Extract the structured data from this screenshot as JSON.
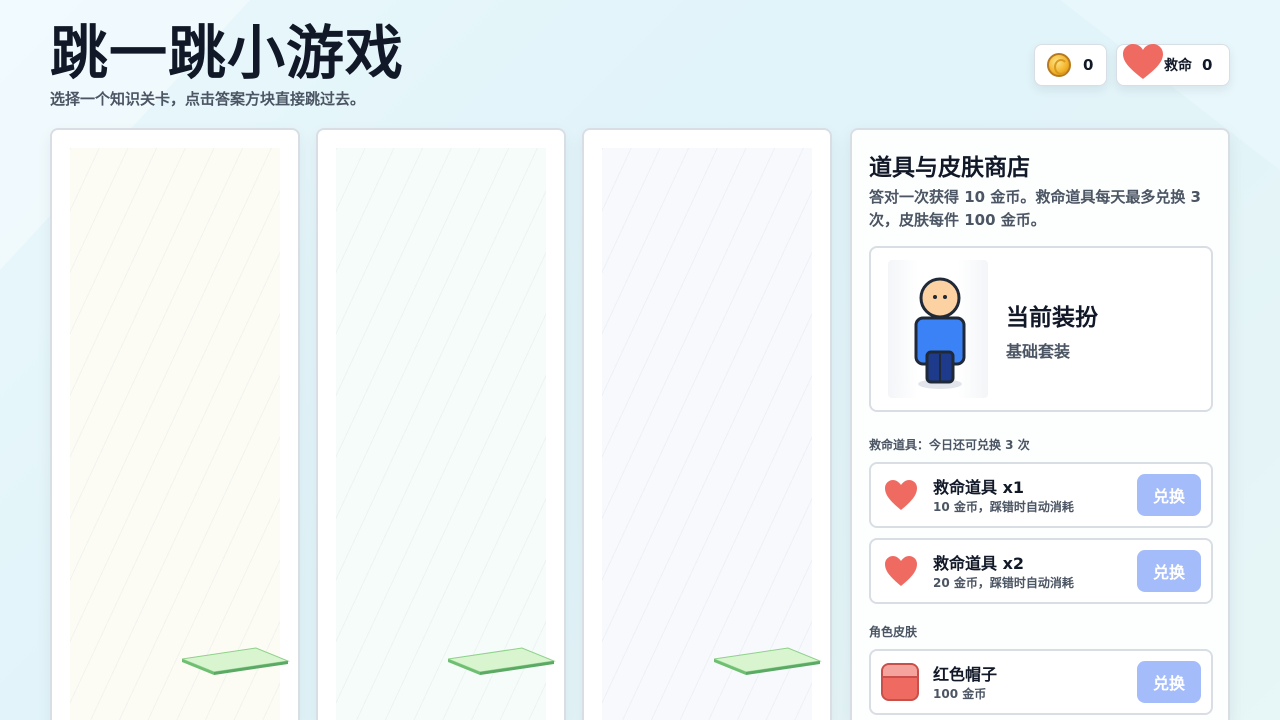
{
  "header": {
    "title": "跳一跳小游戏",
    "subtitle": "选择一个知识关卡，点击答案方块直接跳过去。"
  },
  "stats": {
    "coins": "0",
    "life_label": "救命",
    "life_count": "0"
  },
  "levels": [
    {
      "bg": "#fcfcf4"
    },
    {
      "bg": "#f6fcf9"
    },
    {
      "bg": "#f7f9fd"
    }
  ],
  "shop": {
    "title": "道具与皮肤商店",
    "description": "答对一次获得 10 金币。救命道具每天最多兑换 3 次，皮肤每件 100 金币。",
    "current_outfit": {
      "title": "当前装扮",
      "name": "基础套装"
    },
    "rescue_section_label": "救命道具：今日还可兑换 3 次",
    "rescue_items": [
      {
        "name": "救命道具 x1",
        "desc": "10 金币，踩错时自动消耗",
        "button": "兑换"
      },
      {
        "name": "救命道具 x2",
        "desc": "20 金币，踩错时自动消耗",
        "button": "兑换"
      }
    ],
    "skin_section_label": "角色皮肤",
    "skins": [
      {
        "name": "红色帽子",
        "desc": "100 金币",
        "button": "兑换"
      }
    ]
  },
  "colors": {
    "accent_button": "#a5bcfb",
    "heart": "#ef6b62",
    "platform": "#d8f5d0"
  }
}
